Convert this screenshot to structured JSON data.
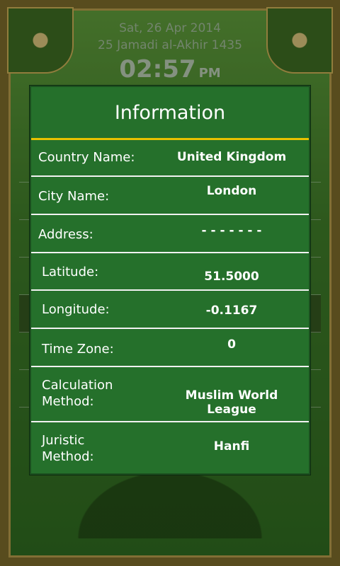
{
  "header": {
    "gregorian_date": "Sat, 26 Apr 2014",
    "hijri_date": "25 Jamadi al-Akhir 1435",
    "time": "02:57",
    "ampm": "PM"
  },
  "dialog": {
    "title": "Information",
    "rows": [
      {
        "label": "Country Name:",
        "value": "United Kingdom"
      },
      {
        "label": "City Name:",
        "value": "London"
      },
      {
        "label": "Address:",
        "value": "- - - - - - -"
      },
      {
        "label": "Latitude:",
        "value": "51.5000"
      },
      {
        "label": "Longitude:",
        "value": "-0.1167"
      },
      {
        "label": "Time Zone:",
        "value": "0"
      },
      {
        "label": "Calculation Method:",
        "value": "Muslim World League"
      },
      {
        "label": "Juristic Method:",
        "value": "Hanfi"
      }
    ]
  },
  "colors": {
    "dialog_bg": "#25702b",
    "title_rule": "#e8c200",
    "separator": "#f2f2f2"
  }
}
